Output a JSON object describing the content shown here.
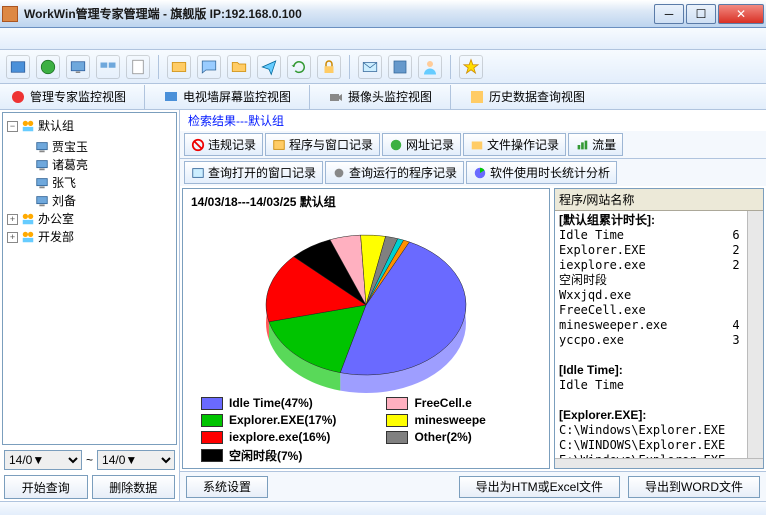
{
  "title": "WorkWin管理专家管理端 - 旗舰版 IP:192.168.0.100",
  "views": {
    "v1": "管理专家监控视图",
    "v2": "电视墙屏幕监控视图",
    "v3": "摄像头监控视图",
    "v4": "历史数据查询视图"
  },
  "tree": {
    "root": "默认组",
    "users": [
      "贾宝玉",
      "诸葛亮",
      "张飞",
      "刘备"
    ],
    "groups": [
      "办公室",
      "开发部"
    ]
  },
  "dates": {
    "from": "14/0▼",
    "to": "14/0▼",
    "sep": "~"
  },
  "sidebtns": {
    "start": "开始查询",
    "del": "删除数据"
  },
  "searchhdr": "检索结果---默认组",
  "tabs": {
    "t1": "违规记录",
    "t2": "程序与窗口记录",
    "t3": "网址记录",
    "t4": "文件操作记录",
    "t5": "流量"
  },
  "subtabs": {
    "s1": "查询打开的窗口记录",
    "s2": "查询运行的程序记录",
    "s3": "软件使用时长统计分析"
  },
  "range": "14/03/18---14/03/25   默认组",
  "chart_data": {
    "type": "pie",
    "title": "",
    "series": [
      {
        "name": "Idle Time",
        "value": 47,
        "color": "#6a6aff"
      },
      {
        "name": "Explorer.EXE",
        "value": 17,
        "color": "#00c400"
      },
      {
        "name": "iexplore.exe",
        "value": 16,
        "color": "#ff0000"
      },
      {
        "name": "空闲时段",
        "value": 7,
        "color": "#000000"
      },
      {
        "name": "FreeCell.exe",
        "value": 5,
        "color": "#ffb0c0"
      },
      {
        "name": "minesweeper.exe",
        "value": 4,
        "color": "#ffff00"
      },
      {
        "name": "Other",
        "value": 2,
        "color": "#808080"
      },
      {
        "name": "(slice)",
        "value": 1,
        "color": "#00d0d0"
      },
      {
        "name": "(slice)",
        "value": 1,
        "color": "#ff9000"
      }
    ]
  },
  "legend": {
    "l1": "Idle Time(47%)",
    "l2": "Explorer.EXE(17%)",
    "l3": "iexplore.exe(16%)",
    "l4": "空闲时段(7%)",
    "r1": "FreeCell.e",
    "r2": "minesweepe",
    "r3": "Other(2%)"
  },
  "listhdr": "程序/网站名称",
  "list": "[默认组累计时长]:\nIdle Time               6\nExplorer.EXE            2\niexplore.exe            2\n空闲时段\nWxxjqd.exe\nFreeCell.exe\nminesweeper.exe         4\nyccpo.exe               3\n\n[Idle Time]:\nIdle Time\n\n[Explorer.EXE]:\nC:\\Windows\\Explorer.EXE\nC:\\WINDOWS\\Explorer.EXE\nE:\\Windows\\Explorer.EXE\n[iexplore.exe]:",
  "btm": {
    "sys": "系统设置",
    "exp1": "导出为HTM或Excel文件",
    "exp2": "导出到WORD文件"
  }
}
